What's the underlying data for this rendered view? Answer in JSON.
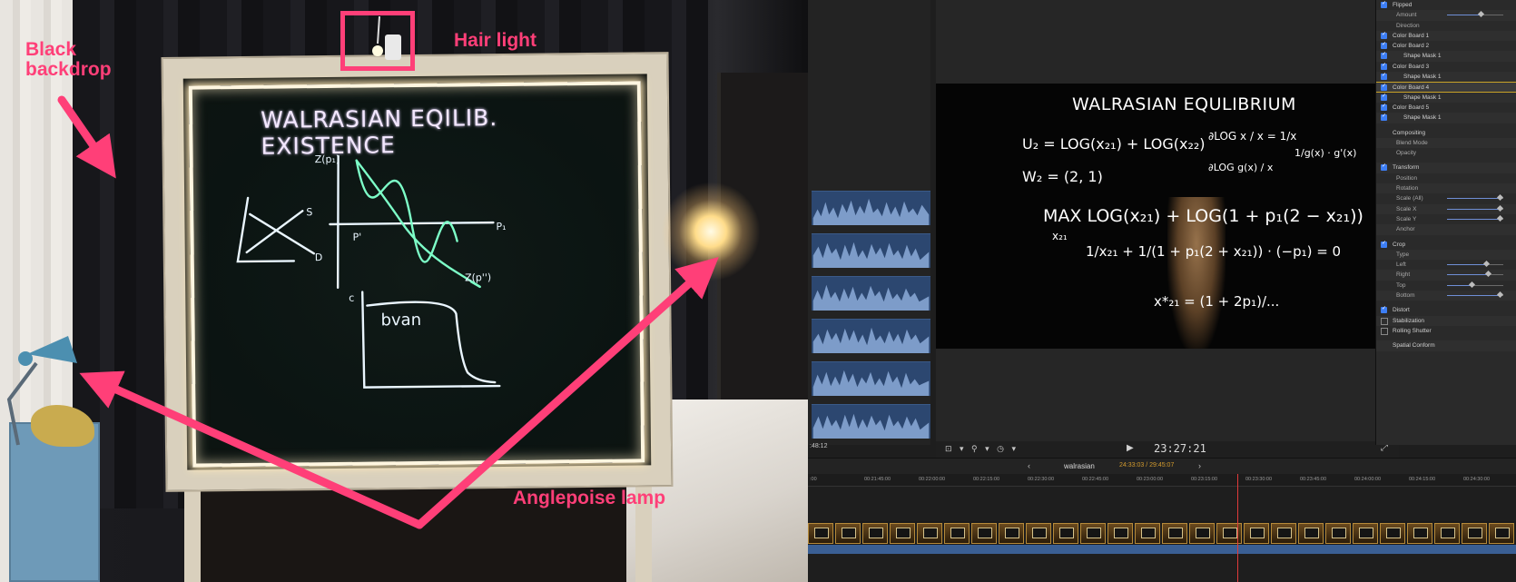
{
  "photo": {
    "board_title": "WALRASIAN EQILIB. EXISTENCE",
    "annotations": {
      "black_backdrop": "Black\nbackdrop",
      "hair_light": "Hair light",
      "anglepoise_lamp": "Anglepoise lamp"
    },
    "accent_color": "#ff3f78"
  },
  "editor": {
    "viewer": {
      "frame_title": "WALRASIAN EQULIBRIUM",
      "timecode": "23:27:21"
    },
    "browser": {
      "time_label": ":48:12"
    },
    "inspector": {
      "rows": [
        {
          "label": "Flipped",
          "kind": "cb"
        },
        {
          "label": "Amount",
          "kind": "sub",
          "slider": true
        },
        {
          "label": "Direction",
          "kind": "sub"
        },
        {
          "label": "Color Board 1",
          "kind": "cb"
        },
        {
          "label": "Color Board 2",
          "kind": "cb"
        },
        {
          "label": "Shape Mask 1",
          "kind": "cb-indent"
        },
        {
          "label": "Color Board 3",
          "kind": "cb"
        },
        {
          "label": "Shape Mask 1",
          "kind": "cb-indent"
        },
        {
          "label": "Color Board 4",
          "kind": "cb-hl"
        },
        {
          "label": "Shape Mask 1",
          "kind": "cb-indent"
        },
        {
          "label": "Color Board 5",
          "kind": "cb"
        },
        {
          "label": "Shape Mask 1",
          "kind": "cb-indent"
        },
        {
          "label": "Compositing",
          "kind": "head"
        },
        {
          "label": "Blend Mode",
          "kind": "sub"
        },
        {
          "label": "Opacity",
          "kind": "sub"
        },
        {
          "label": "Transform",
          "kind": "cb"
        },
        {
          "label": "Position",
          "kind": "sub"
        },
        {
          "label": "Rotation",
          "kind": "sub"
        },
        {
          "label": "Scale (All)",
          "kind": "sub",
          "slider": true
        },
        {
          "label": "Scale X",
          "kind": "sub",
          "slider": true
        },
        {
          "label": "Scale Y",
          "kind": "sub",
          "slider": true
        },
        {
          "label": "Anchor",
          "kind": "sub"
        },
        {
          "label": "Crop",
          "kind": "cb"
        },
        {
          "label": "Type",
          "kind": "sub"
        },
        {
          "label": "Left",
          "kind": "sub",
          "slider": true
        },
        {
          "label": "Right",
          "kind": "sub",
          "slider": true
        },
        {
          "label": "Top",
          "kind": "sub",
          "slider": true
        },
        {
          "label": "Bottom",
          "kind": "sub",
          "slider": true
        },
        {
          "label": "Distort",
          "kind": "cb"
        },
        {
          "label": "Stabilization",
          "kind": "box"
        },
        {
          "label": "Rolling Shutter",
          "kind": "box"
        },
        {
          "label": "Spatial Conform",
          "kind": "head"
        }
      ]
    },
    "timeline": {
      "project_name": "walrasian",
      "duration": "24:33:03 / 29:45:07",
      "ruler_ticks": [
        ":00",
        "00:21:45:00",
        "00:22:00:00",
        "00:22:15:00",
        "00:22:30:00",
        "00:22:45:00",
        "00:23:00:00",
        "00:23:15:00",
        "00:23:30:00",
        "00:23:45:00",
        "00:24:00:00",
        "00:24:15:00",
        "00:24:30:00"
      ]
    }
  }
}
